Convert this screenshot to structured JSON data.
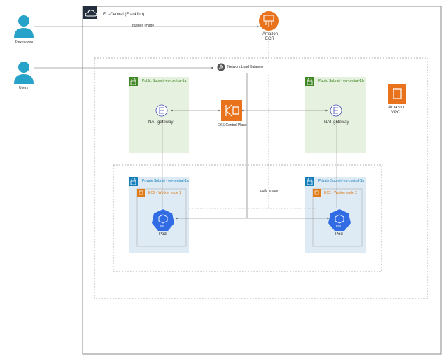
{
  "region": {
    "label": "EU-Central (Frankfurt)"
  },
  "actors": {
    "developers": "Developers",
    "users": "Users"
  },
  "ecr": {
    "line1": "Amazon",
    "line2": "ECR"
  },
  "vpc": {
    "line1": "Amazon",
    "line2": "VPC"
  },
  "nlb": {
    "label": "Network Load Balancer"
  },
  "eks": {
    "label": "EKS Control Plane"
  },
  "public_subnets": [
    {
      "label": "Public Subnet -eu-central-1a",
      "nat_label": "NAT gateway"
    },
    {
      "label": "Public Subnet - eu-central-1b",
      "nat_label": "NAT gateway"
    }
  ],
  "private_subnets": [
    {
      "label": "Private Subnet - eu-central-1a",
      "node_label": "EC2 - Worker node 1",
      "pod_label": "Pod",
      "pod_badge": "pod"
    },
    {
      "label": "Private Subnet -eu-central-1b",
      "node_label": "EC2 - Worker node 2",
      "pod_label": "Pod",
      "pod_badge": "pod"
    }
  ],
  "edges": {
    "pushes": "pushes image",
    "pulls": "pulls image"
  },
  "colors": {
    "public_fill": "#e6f1df",
    "public_accent": "#3f8624",
    "private_fill": "#deebf5",
    "private_accent": "#147eba",
    "ec2_accent": "#e07b1a",
    "orange": "#e8731c",
    "k8s_blue": "#326ce5",
    "person": "#27a2c8"
  }
}
